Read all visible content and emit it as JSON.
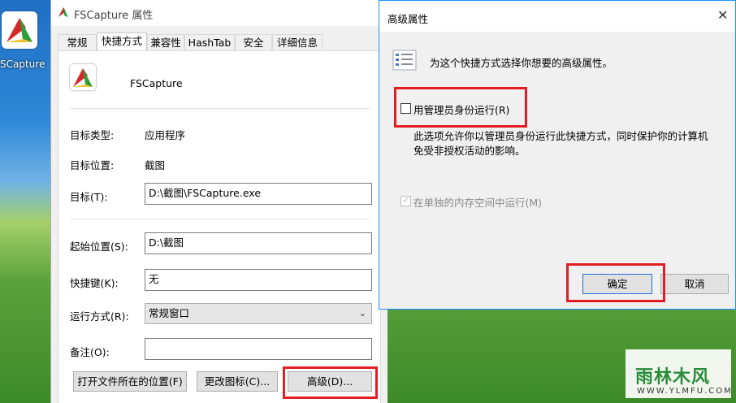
{
  "desktop": {
    "icon_label": "SCapture"
  },
  "props": {
    "title": "FSCapture 属性",
    "tabs": [
      "常规",
      "快捷方式",
      "兼容性",
      "HashTab",
      "安全",
      "详细信息"
    ],
    "app_name": "FSCapture",
    "target_type_label": "目标类型:",
    "target_type_value": "应用程序",
    "target_location_label": "目标位置:",
    "target_location_value": "截图",
    "target_label": "目标(T):",
    "target_value": "D:\\截图\\FSCapture.exe",
    "start_in_label": "起始位置(S):",
    "start_in_value": "D:\\截图",
    "shortcut_key_label": "快捷键(K):",
    "shortcut_key_value": "无",
    "run_label": "运行方式(R):",
    "run_value": "常规窗口",
    "comment_label": "备注(O):",
    "comment_value": "",
    "open_location_button": "打开文件所在的位置(F)",
    "change_icon_button": "更改图标(C)...",
    "advanced_button": "高级(D)..."
  },
  "advanced": {
    "title": "高级属性",
    "description": "为这个快捷方式选择你想要的高级属性。",
    "run_as_admin_label": "用管理员身份运行(R)",
    "run_as_admin_checked": false,
    "note_line1": "此选项允许你以管理员身份运行此快捷方式，同时保护你的计算机",
    "note_line2": "免受非授权活动的影响。",
    "separate_memory_label": "在单独的内存空间中运行(M)",
    "separate_memory_checked": true,
    "ok_button": "确定",
    "cancel_button": "取消"
  },
  "watermark": {
    "line1": "雨林木风",
    "line2": "WWW.YLMFU.COM"
  },
  "colors": {
    "highlight": "#e41c24",
    "dialog_border": "#1e90ff"
  }
}
